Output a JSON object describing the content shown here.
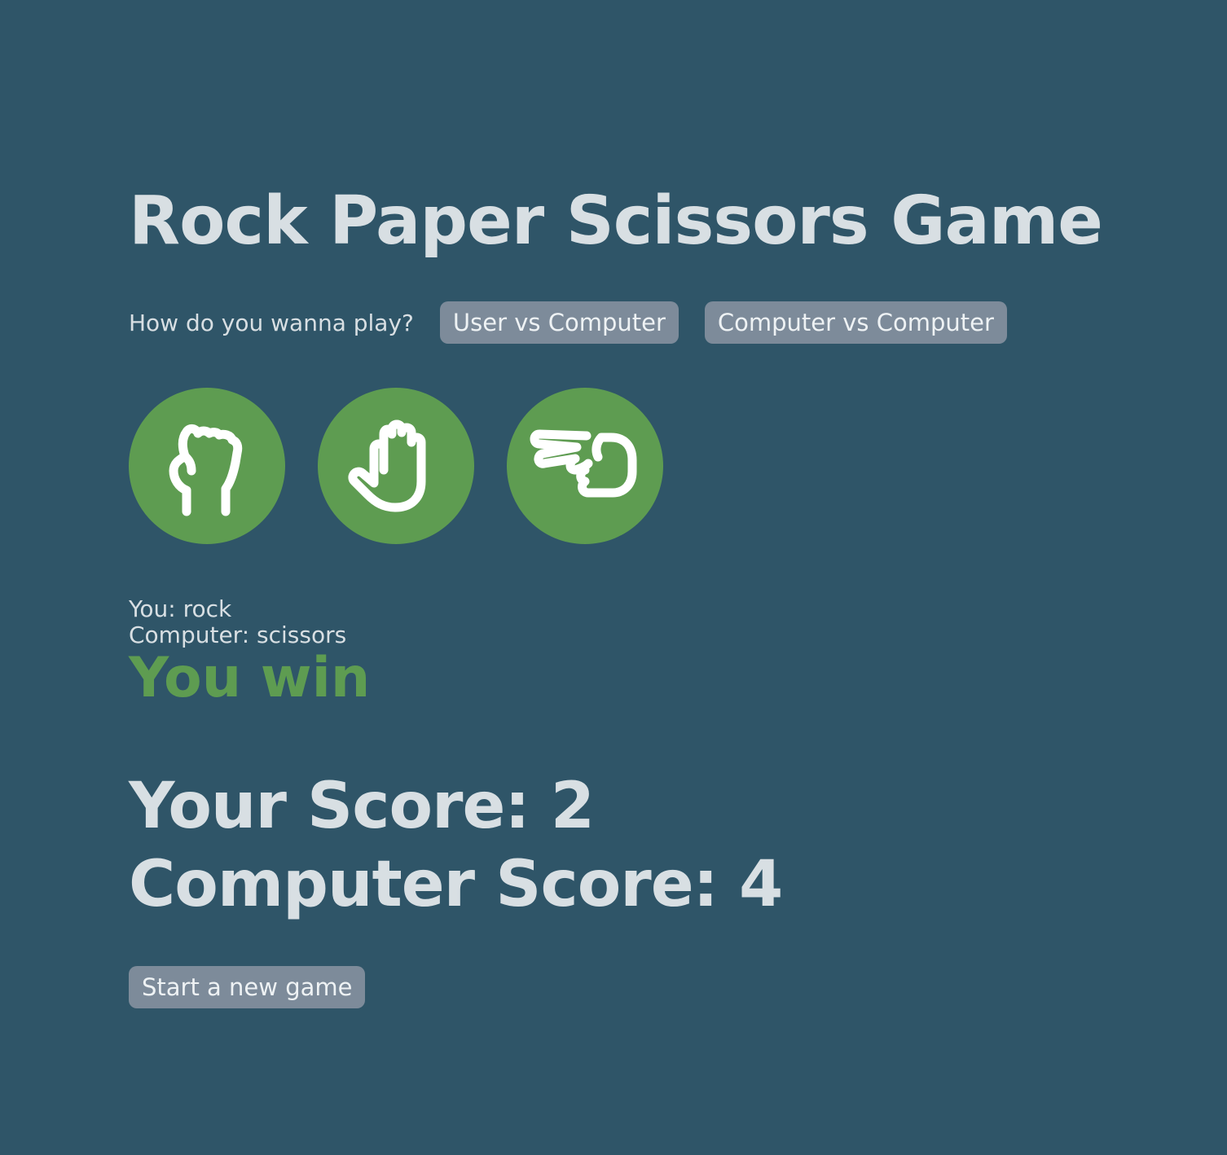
{
  "title": "Rock Paper Scissors Game",
  "mode": {
    "prompt": "How do you wanna play?",
    "options": [
      "User vs Computer",
      "Computer vs Computer"
    ]
  },
  "choices": [
    {
      "name": "rock",
      "icon": "rock-hand-icon"
    },
    {
      "name": "paper",
      "icon": "paper-hand-icon"
    },
    {
      "name": "scissors",
      "icon": "scissors-hand-icon"
    }
  ],
  "result": {
    "you": "You: rock",
    "computer": "Computer: scissors",
    "outcome": "You win"
  },
  "scores": {
    "user": "Your Score: 2",
    "computer": "Computer Score: 4"
  },
  "new_game_label": "Start a new game",
  "colors": {
    "background": "#2f5568",
    "accent_green": "#5e9c51",
    "button_gray": "#7d8b9a",
    "text_light": "#d8dfe3"
  }
}
